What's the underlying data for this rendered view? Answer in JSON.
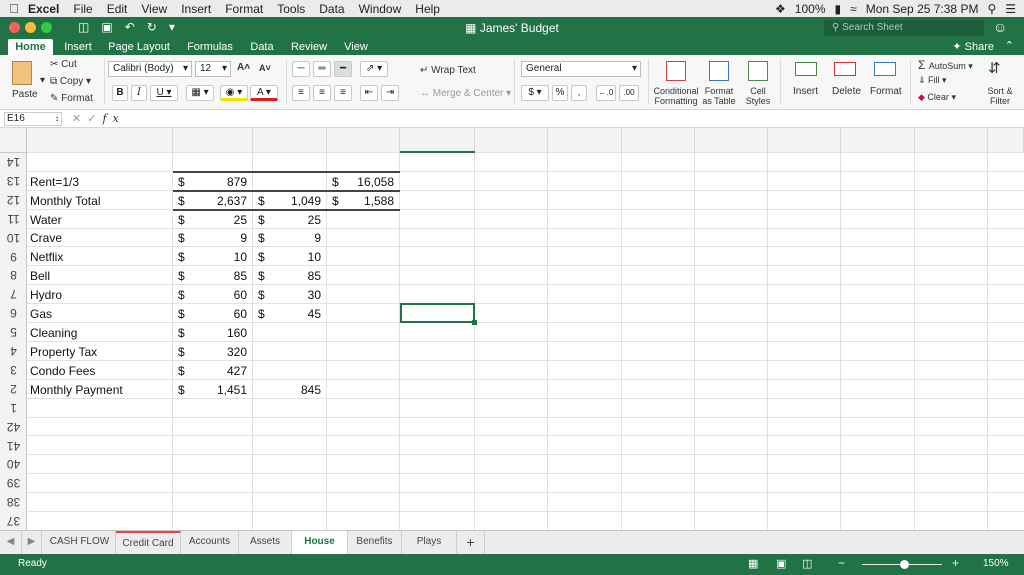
{
  "menubar": {
    "app": "Excel",
    "items": [
      "File",
      "Edit",
      "View",
      "Insert",
      "Format",
      "Tools",
      "Data",
      "Window",
      "Help"
    ],
    "battery": "100%",
    "clock": "Mon Sep 25  7:38 PM"
  },
  "window": {
    "title": "James' Budget",
    "search_placeholder": "Search Sheet",
    "share": "Share"
  },
  "ribbon_tabs": [
    "Home",
    "Insert",
    "Page Layout",
    "Formulas",
    "Data",
    "Review",
    "View"
  ],
  "ribbon": {
    "paste": "Paste",
    "cut": "Cut",
    "copy": "Copy",
    "format_painter": "Format",
    "font_name": "Calibri (Body)",
    "font_size": "12",
    "wrap_text": "Wrap Text",
    "merge_center": "Merge & Center",
    "number_format": "General",
    "conditional_formatting": [
      "Conditional",
      "Formatting"
    ],
    "format_as_table": [
      "Format",
      "as Table"
    ],
    "cell_styles": [
      "Cell",
      "Styles"
    ],
    "insert": "Insert",
    "delete": "Delete",
    "format": "Format",
    "autosum": "AutoSum",
    "fill": "Fill",
    "clear": "Clear",
    "sort_filter": [
      "Sort &",
      "Filter"
    ]
  },
  "formula_bar": {
    "name_box": "E16",
    "fx_label": "fx",
    "formula": ""
  },
  "sheet": {
    "row_numbers": [
      "14",
      "13",
      "12",
      "11",
      "10",
      "9",
      "8",
      "7",
      "6",
      "5",
      "4",
      "3",
      "2",
      "1",
      "42",
      "41",
      "40",
      "39",
      "38",
      "37"
    ],
    "rows": [
      {
        "label": "",
        "a": "",
        "b": "",
        "c": "",
        "d": "",
        "e": "",
        "f": ""
      },
      {
        "label": "Rent=1/3",
        "a": "$",
        "b": "879",
        "c": "",
        "d": "",
        "e": "$",
        "f": "16,058"
      },
      {
        "label": "Monthly Total",
        "a": "$",
        "b": "2,637",
        "c": "$",
        "d": "1,049",
        "e": "$",
        "f": "1,588"
      },
      {
        "label": "Water",
        "a": "$",
        "b": "25",
        "c": "$",
        "d": "25",
        "e": "",
        "f": ""
      },
      {
        "label": "Crave",
        "a": "$",
        "b": "9",
        "c": "$",
        "d": "9",
        "e": "",
        "f": ""
      },
      {
        "label": "Netflix",
        "a": "$",
        "b": "10",
        "c": "$",
        "d": "10",
        "e": "",
        "f": ""
      },
      {
        "label": "Bell",
        "a": "$",
        "b": "85",
        "c": "$",
        "d": "85",
        "e": "",
        "f": ""
      },
      {
        "label": "Hydro",
        "a": "$",
        "b": "60",
        "c": "$",
        "d": "30",
        "e": "",
        "f": ""
      },
      {
        "label": "Gas",
        "a": "$",
        "b": "60",
        "c": "$",
        "d": "45",
        "e": "",
        "f": ""
      },
      {
        "label": "Cleaning",
        "a": "$",
        "b": "160",
        "c": "",
        "d": "",
        "e": "",
        "f": ""
      },
      {
        "label": "Property Tax",
        "a": "$",
        "b": "320",
        "c": "",
        "d": "",
        "e": "",
        "f": ""
      },
      {
        "label": "Condo Fees",
        "a": "$",
        "b": "427",
        "c": "",
        "d": "",
        "e": "",
        "f": ""
      },
      {
        "label": "Monthly Payment",
        "a": "$",
        "b": "1,451",
        "c": "",
        "d": "845",
        "e": "",
        "f": ""
      }
    ]
  },
  "sheet_tabs": [
    "CASH FLOW",
    "Credit Card",
    "Accounts",
    "Assets",
    "House",
    "Benefits",
    "Plays"
  ],
  "active_sheet": "House",
  "status": {
    "ready": "Ready",
    "zoom": "150%"
  },
  "colors": {
    "brand": "#217346",
    "tab_accent": "#e04a4a"
  }
}
